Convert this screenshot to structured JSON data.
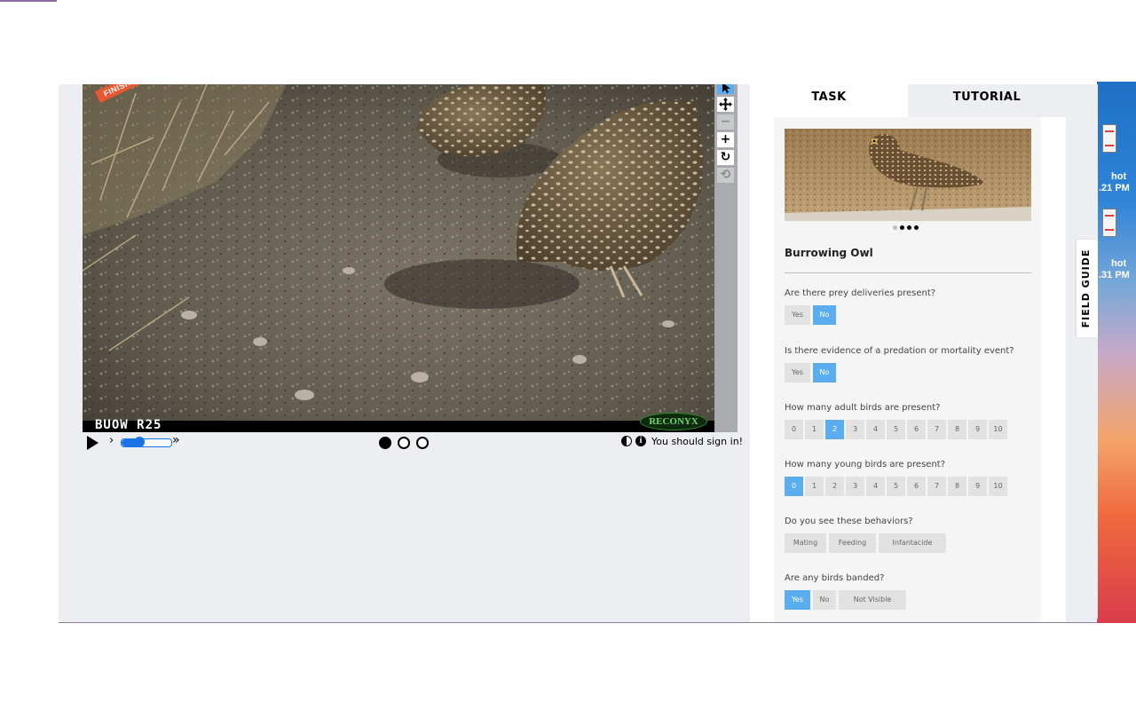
{
  "viewer": {
    "ribbon_text": "FINISHED",
    "camera_label": "BUOW  R25",
    "watermark": "RECONYX",
    "frames": {
      "count": 3,
      "current": 1
    },
    "speed_level": 0.25,
    "sign_in_message": "You should sign in!"
  },
  "toolbar": {
    "pointer_icon": "pointer-icon",
    "move_icon": "move-icon",
    "zoom_out_label": "−",
    "zoom_in_label": "+",
    "rotate_label": "↻",
    "reset_label": "⟲"
  },
  "tabs": {
    "task": "TASK",
    "tutorial": "TUTORIAL"
  },
  "task": {
    "carousel": {
      "count": 4,
      "current": 1
    },
    "species": "Burrowing Owl",
    "questions": [
      {
        "text": "Are there prey deliveries present?",
        "answers": [
          "Yes",
          "No"
        ],
        "selected": [
          1
        ]
      },
      {
        "text": "Is there evidence of a predation or mortality event?",
        "answers": [
          "Yes",
          "No"
        ],
        "selected": [
          1
        ]
      },
      {
        "text": "How many adult birds are present?",
        "answers": [
          "0",
          "1",
          "2",
          "3",
          "4",
          "5",
          "6",
          "7",
          "8",
          "9",
          "10"
        ],
        "selected": [
          2
        ]
      },
      {
        "text": "How many young birds are present?",
        "answers": [
          "0",
          "1",
          "2",
          "3",
          "4",
          "5",
          "6",
          "7",
          "8",
          "9",
          "10"
        ],
        "selected": [
          0
        ]
      },
      {
        "text": "Do you see these behaviors?",
        "answers": [
          "Mating",
          "Feeding",
          "Infantacide"
        ],
        "selected": []
      },
      {
        "text": "Are any birds banded?",
        "answers": [
          "Yes",
          "No",
          "Not Visible"
        ],
        "selected": [
          0
        ]
      }
    ]
  },
  "field_guide": {
    "label": "FIELD GUIDE"
  },
  "desktop": {
    "items": [
      {
        "line1": "hot",
        "line2": ".21 PM"
      },
      {
        "line1": "hot",
        "line2": ".31 PM"
      }
    ]
  }
}
